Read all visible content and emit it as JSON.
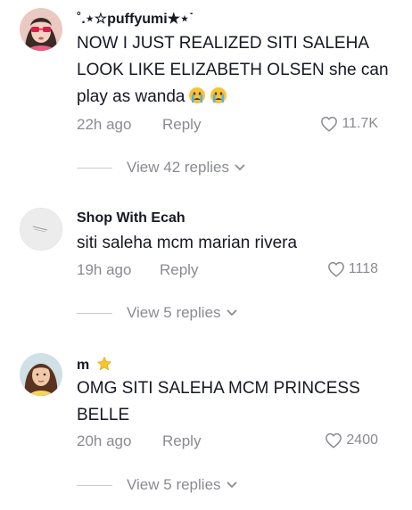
{
  "comments": [
    {
      "username": "˚.⋆☆puffyumi★⋆˙",
      "text": "NOW I JUST REALIZED SITI SALEHA LOOK LIKE ELIZABETH OLSEN she can play as wanda",
      "emoji": [
        "crying-face",
        "crying-face"
      ],
      "time": "22h ago",
      "reply_label": "Reply",
      "likes": "11.7K",
      "view_replies": "View 42 replies"
    },
    {
      "username": "Shop With Ecah",
      "text": "siti saleha mcm marian rivera",
      "time": "19h ago",
      "reply_label": "Reply",
      "likes": "1118",
      "view_replies": "View 5 replies"
    },
    {
      "username": "m",
      "username_badge": "star-emoji",
      "text": "OMG SITI SALEHA MCM PRINCESS BELLE",
      "time": "20h ago",
      "reply_label": "Reply",
      "likes": "2400",
      "view_replies": "View 5 replies"
    }
  ],
  "colors": {
    "primary_text": "#161823",
    "secondary_text": "#8a8b91",
    "star": "#f7c52b"
  }
}
